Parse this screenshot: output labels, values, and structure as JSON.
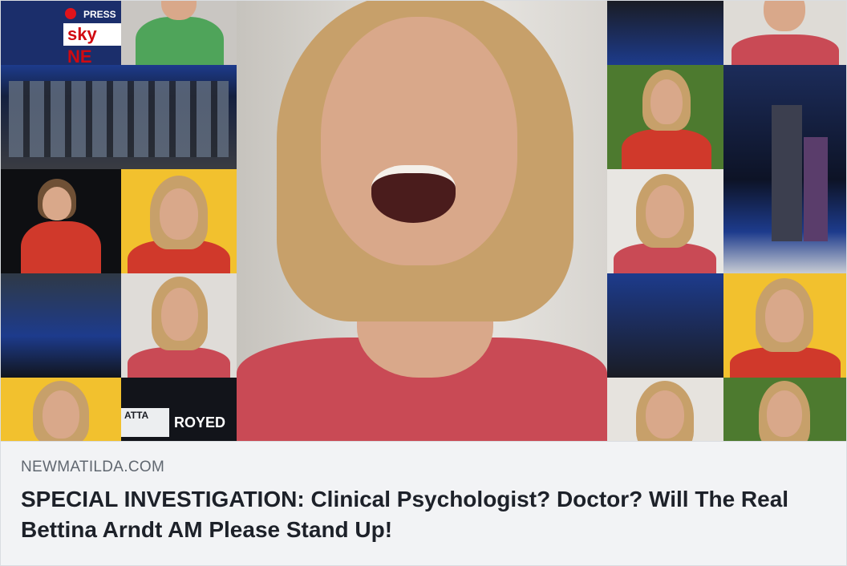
{
  "link_preview": {
    "domain": "NEWMATILDA.COM",
    "headline": "SPECIAL INVESTIGATION: Clinical Psychologist? Doctor? Will The Real Bettina Arndt AM Please Stand Up!"
  },
  "hero_image": {
    "tv_logo_text": "sky NE",
    "press_text": "PRESS",
    "caption_fragments": [
      "ATTA",
      "ROYED"
    ],
    "colors": {
      "skin": "#d9a88a",
      "hair": "#c7a06a",
      "red_top": "#d0392b",
      "pink_top": "#c94a55",
      "studio_blue": "#1d3b8c",
      "studio_dark": "#1a1c24",
      "yellow_bg": "#f2c12e"
    }
  }
}
